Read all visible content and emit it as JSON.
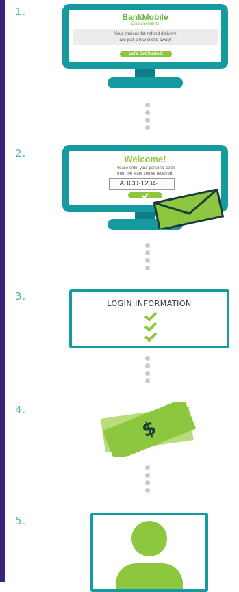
{
  "steps": [
    {
      "number": "1."
    },
    {
      "number": "2."
    },
    {
      "number": "3."
    },
    {
      "number": "4."
    },
    {
      "number": "5."
    }
  ],
  "step1": {
    "brand": "BankMobile",
    "brand_sub": "Disbursements",
    "message_line1": "Your choices for refund delivery",
    "message_line2": "are just a few clicks away!",
    "button": "Let's Get Started!"
  },
  "step2": {
    "title": "Welcome!",
    "line1": "Please enter your personal code",
    "line2": "from the letter you've received.",
    "code": "ABCD-1234-..."
  },
  "step3": {
    "title": "LOGIN INFORMATION"
  },
  "step4": {
    "symbol": "$"
  },
  "colors": {
    "teal": "#159aa0",
    "green": "#8dc63f",
    "purple": "#3b2477"
  }
}
